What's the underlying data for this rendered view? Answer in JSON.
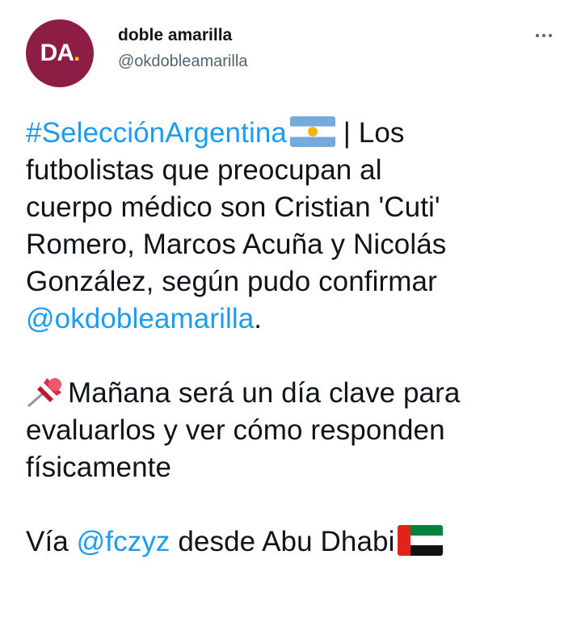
{
  "author": {
    "avatar_text": "DA",
    "avatar_dot": ".",
    "display_name": "doble amarilla",
    "handle": "@okdobleamarilla"
  },
  "tweet": {
    "hashtag": "#SelecciónArgentina",
    "line1_rest": " | Los",
    "line2": "futbolistas que preocupan al",
    "line3": "cuerpo médico son Cristian 'Cuti'",
    "line4": "Romero, Marcos Acuña y Nicolás",
    "line5": "González, según pudo confirmar",
    "mention1": "@okdobleamarilla",
    "mention1_after": ".",
    "para2_line1": "Mañana será un día clave para",
    "para2_line2": "evaluarlos y ver cómo responden",
    "para2_line3": "físicamente",
    "via_prefix": "Vía ",
    "mention2": "@fczyz",
    "via_suffix": " desde Abu Dhabi"
  },
  "icons": {
    "argentina_flag": "argentina-flag-icon",
    "pushpin": "pushpin-icon",
    "uae_flag": "uae-flag-icon",
    "more": "more-icon"
  },
  "colors": {
    "avatar_bg": "#8e1d46",
    "avatar_dot": "#f4c21a",
    "link": "#1d9bf0",
    "text": "#0f1419",
    "secondary": "#536471"
  }
}
